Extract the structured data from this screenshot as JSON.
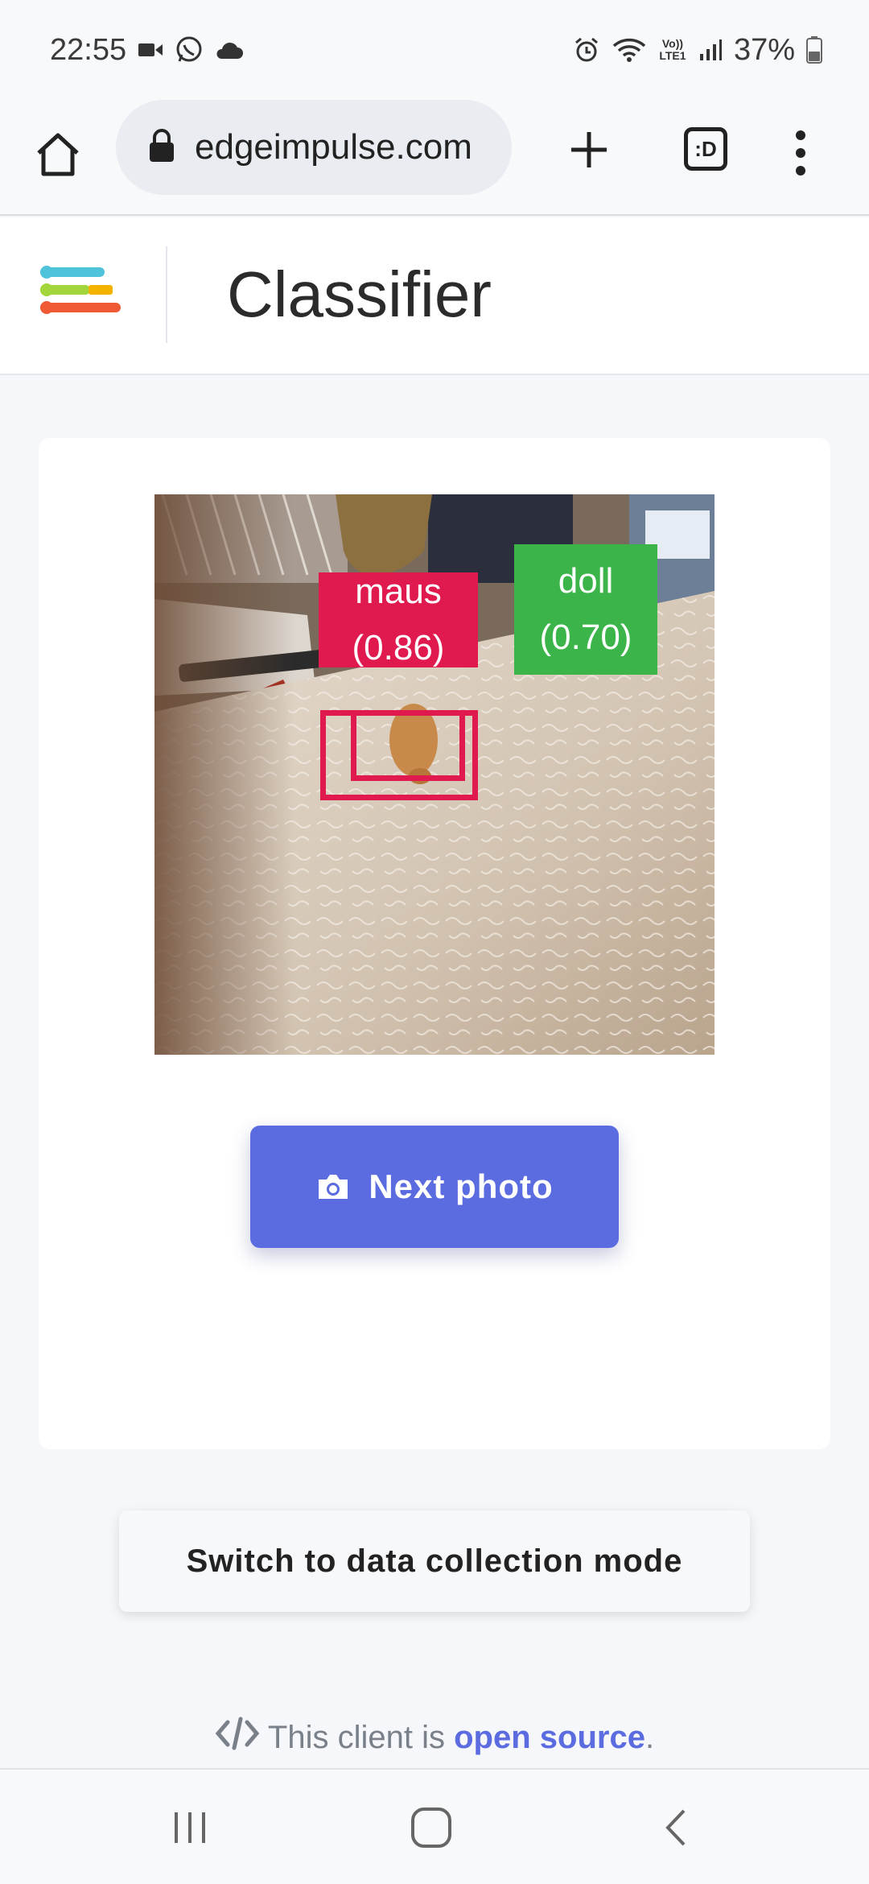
{
  "status_bar": {
    "time": "22:55",
    "battery_percent": "37%",
    "icons_left": [
      "video-icon",
      "whatsapp-icon",
      "cloud-icon"
    ],
    "icons_right": [
      "alarm-icon",
      "wifi-icon",
      "volte-icon",
      "signal-icon",
      "battery-icon"
    ],
    "volte_text": "Vo)) LTE1"
  },
  "browser": {
    "url": "edgeimpulse.com",
    "tabs_label": ":D"
  },
  "header": {
    "title": "Classifier",
    "logo_colors": [
      "#4fc3d9",
      "#a3d63c",
      "#f5b300",
      "#ef5a35"
    ]
  },
  "detections": [
    {
      "label": "maus",
      "score": "(0.86)",
      "color": "#e0194f"
    },
    {
      "label": "doll",
      "score": "(0.70)",
      "color": "#3bb54a"
    }
  ],
  "actions": {
    "next_photo": "Next photo",
    "switch_mode": "Switch to data collection mode"
  },
  "footer": {
    "prefix": "This client is",
    "link": "open source",
    "suffix": "."
  },
  "colors": {
    "primary": "#5b6be0",
    "background": "#f5f7fa"
  }
}
